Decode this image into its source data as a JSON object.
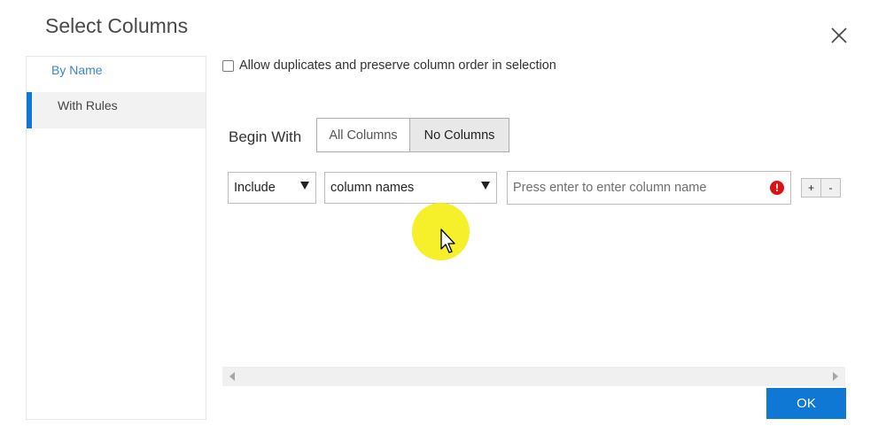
{
  "dialog": {
    "title": "Select Columns",
    "close_icon": "close-icon"
  },
  "sidebar": {
    "items": [
      {
        "label": "By Name",
        "active": false
      },
      {
        "label": "With Rules",
        "active": true
      }
    ]
  },
  "options": {
    "allow_duplicates_label": "Allow duplicates and preserve column order in selection",
    "allow_duplicates_checked": false
  },
  "begin_with": {
    "label": "Begin With",
    "options": [
      "All Columns",
      "No Columns"
    ],
    "selected": "No Columns"
  },
  "rule": {
    "mode_value": "Include",
    "target_value": "column names",
    "column_input_value": "",
    "column_input_placeholder": "Press enter to enter column name",
    "error_icon_glyph": "!",
    "add_label": "+",
    "remove_label": "-"
  },
  "footer": {
    "ok_label": "OK"
  },
  "colors": {
    "accent": "#0f78d4",
    "error": "#d91313",
    "cursor_highlight": "#f4ef1f"
  }
}
